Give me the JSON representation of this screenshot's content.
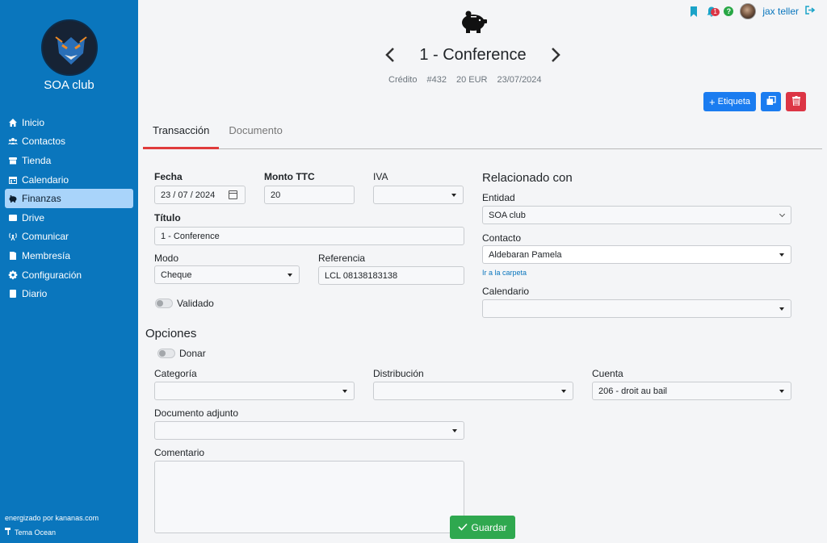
{
  "sidebar": {
    "club_name": "SOA club",
    "items": [
      {
        "label": "Inicio",
        "icon": "home-icon"
      },
      {
        "label": "Contactos",
        "icon": "users-icon"
      },
      {
        "label": "Tienda",
        "icon": "store-icon"
      },
      {
        "label": "Calendario",
        "icon": "calendar-icon"
      },
      {
        "label": "Finanzas",
        "icon": "piggy-bank-icon",
        "active": true
      },
      {
        "label": "Drive",
        "icon": "drive-icon"
      },
      {
        "label": "Comunicar",
        "icon": "broadcast-icon"
      },
      {
        "label": "Membresía",
        "icon": "membership-icon"
      },
      {
        "label": "Configuración",
        "icon": "gear-icon"
      },
      {
        "label": "Diario",
        "icon": "journal-icon"
      }
    ],
    "powered_by": "energizado por kananas.com",
    "theme": "Tema Ocean"
  },
  "topbar": {
    "notification_count": "1",
    "help": "?",
    "username": "jax teller"
  },
  "header": {
    "title": "1 - Conference",
    "type": "Crédito",
    "number": "#432",
    "amount": "20 EUR",
    "date": "23/07/2024",
    "tag_button": "Etiqueta"
  },
  "tabs": [
    "Transacción",
    "Documento"
  ],
  "form": {
    "fecha_label": "Fecha",
    "fecha_value": "23 / 07 / 2024",
    "monto_label": "Monto TTC",
    "monto_value": "20",
    "iva_label": "IVA",
    "iva_value": "",
    "titulo_label": "Título",
    "titulo_value": "1 - Conference",
    "modo_label": "Modo",
    "modo_value": "Cheque",
    "referencia_label": "Referencia",
    "referencia_value": "LCL 08138183138",
    "validado_label": "Validado",
    "relacionado_heading": "Relacionado con",
    "entidad_label": "Entidad",
    "entidad_value": "SOA club",
    "contacto_label": "Contacto",
    "contacto_value": "Aldebaran Pamela",
    "carpeta_link": "Ir a la carpeta",
    "calendario_label": "Calendario",
    "calendario_value": "",
    "opciones_heading": "Opciones",
    "donar_label": "Donar",
    "categoria_label": "Categoría",
    "categoria_value": "",
    "distribucion_label": "Distribución",
    "distribucion_value": "",
    "cuenta_label": "Cuenta",
    "cuenta_value": "206 - droit au bail",
    "documento_label": "Documento adjunto",
    "documento_value": "",
    "comentario_label": "Comentario",
    "comentario_value": ""
  },
  "save_button": "Guardar",
  "colors": {
    "sidebar_bg": "#0a76bd",
    "active_item_bg": "#a9d4fa",
    "primary": "#1a7cf0",
    "danger": "#dc3545",
    "success": "#2fa84f",
    "tab_underline": "#e03b3b"
  }
}
